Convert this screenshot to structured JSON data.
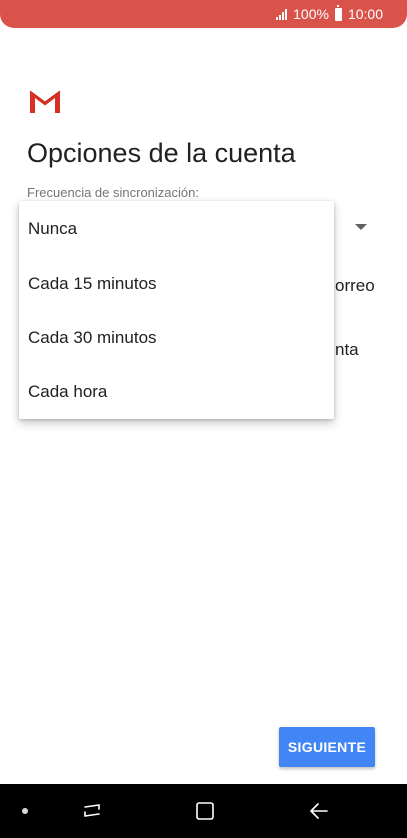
{
  "status_bar": {
    "battery": "100%",
    "time": "10:00",
    "icons": [
      "signal-icon",
      "battery-icon"
    ]
  },
  "app": {
    "logo": "gmail-logo"
  },
  "page": {
    "title": "Opciones de la cuenta",
    "sync_label": "Frecuencia de sincronización:",
    "behind_text_1": "orreo",
    "behind_text_2": "nta"
  },
  "dropdown": {
    "options": [
      "Nunca",
      "Cada 15 minutos",
      "Cada 30 minutos",
      "Cada hora"
    ]
  },
  "footer": {
    "next_label": "SIGUIENTE"
  },
  "nav_bar": {
    "icons": [
      "nav-dot-icon",
      "recent-apps-icon",
      "home-icon",
      "back-icon"
    ]
  },
  "colors": {
    "status_bar": "#d9534a",
    "accent": "#4285f4",
    "gmail_red": "#d93025"
  }
}
